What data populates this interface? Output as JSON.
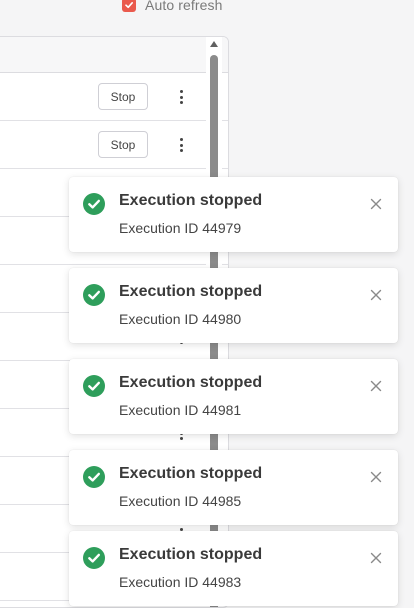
{
  "auto_refresh": {
    "label": "Auto refresh",
    "checked": true,
    "color": "#ea5a4d"
  },
  "table": {
    "rows": [
      {
        "action_label": "Stop",
        "has_stop": true
      },
      {
        "action_label": "Stop",
        "has_stop": true
      },
      {
        "action_label": "",
        "has_stop": false
      },
      {
        "action_label": "",
        "has_stop": false
      },
      {
        "action_label": "",
        "has_stop": false
      },
      {
        "action_label": "",
        "has_stop": false
      },
      {
        "action_label": "",
        "has_stop": false
      },
      {
        "action_label": "",
        "has_stop": false
      },
      {
        "action_label": "",
        "has_stop": false
      },
      {
        "action_label": "",
        "has_stop": false
      },
      {
        "action_label": "",
        "has_stop": false
      }
    ],
    "row_menu_icon": "vertical-ellipsis-icon"
  },
  "toasts": [
    {
      "title": "Execution stopped",
      "message": "Execution ID 44979",
      "icon": "check-circle-icon",
      "close_icon": "close-icon"
    },
    {
      "title": "Execution stopped",
      "message": "Execution ID 44980",
      "icon": "check-circle-icon",
      "close_icon": "close-icon"
    },
    {
      "title": "Execution stopped",
      "message": "Execution ID 44981",
      "icon": "check-circle-icon",
      "close_icon": "close-icon"
    },
    {
      "title": "Execution stopped",
      "message": "Execution ID 44985",
      "icon": "check-circle-icon",
      "close_icon": "close-icon"
    },
    {
      "title": "Execution stopped",
      "message": "Execution ID 44983",
      "icon": "check-circle-icon",
      "close_icon": "close-icon"
    }
  ],
  "colors": {
    "success": "#2e9e5b",
    "accent": "#ea5a4d"
  }
}
